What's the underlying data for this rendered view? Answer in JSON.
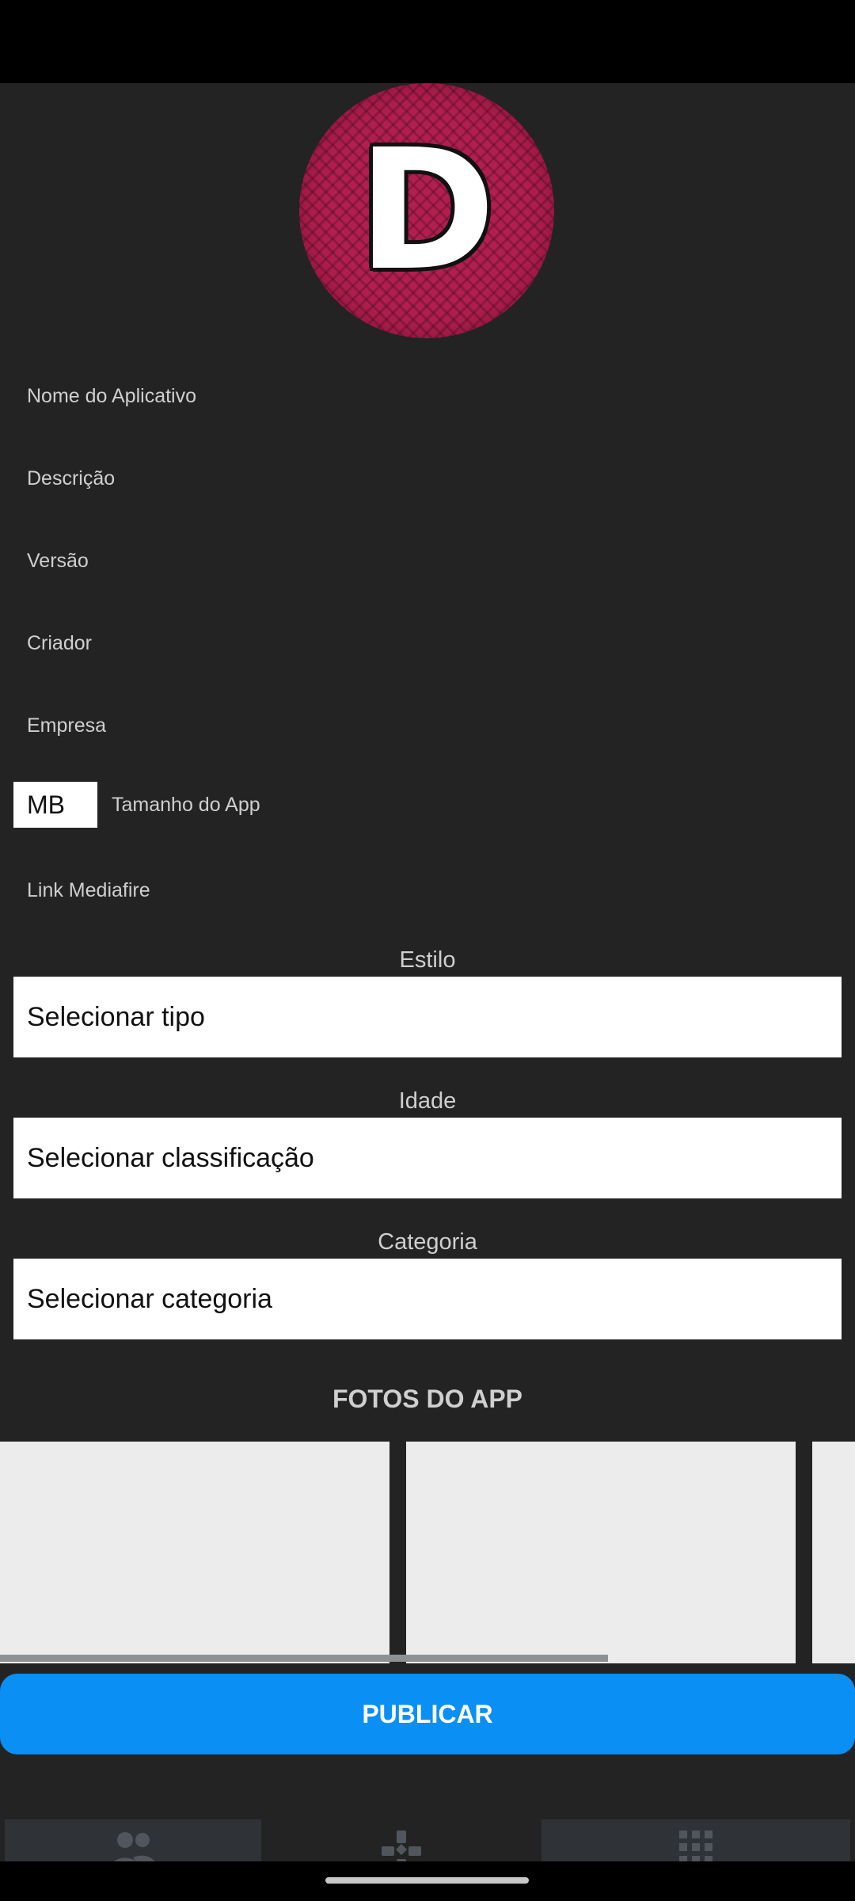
{
  "avatar": {
    "letter": "D",
    "color": "#b01f4e"
  },
  "form": {
    "app_name_placeholder": "Nome do Aplicativo",
    "description_placeholder": "Descrição",
    "version_placeholder": "Versão",
    "creator_placeholder": "Criador",
    "company_placeholder": "Empresa",
    "size_unit": "MB",
    "size_placeholder": "Tamanho do App",
    "link_placeholder": "Link Mediafire"
  },
  "style": {
    "label": "Estilo",
    "value": "Selecionar tipo"
  },
  "age": {
    "label": "Idade",
    "value": "Selecionar classificação"
  },
  "category": {
    "label": "Categoria",
    "value": "Selecionar categoria"
  },
  "photos": {
    "title": "FOTOS DO APP"
  },
  "publish": {
    "label": "PUBLICAR",
    "color": "#0a8ff5"
  },
  "bottom_nav": {
    "items": [
      {
        "icon": "people-icon"
      },
      {
        "icon": "gamepad-icon"
      },
      {
        "icon": "grid-apps-icon"
      }
    ]
  }
}
